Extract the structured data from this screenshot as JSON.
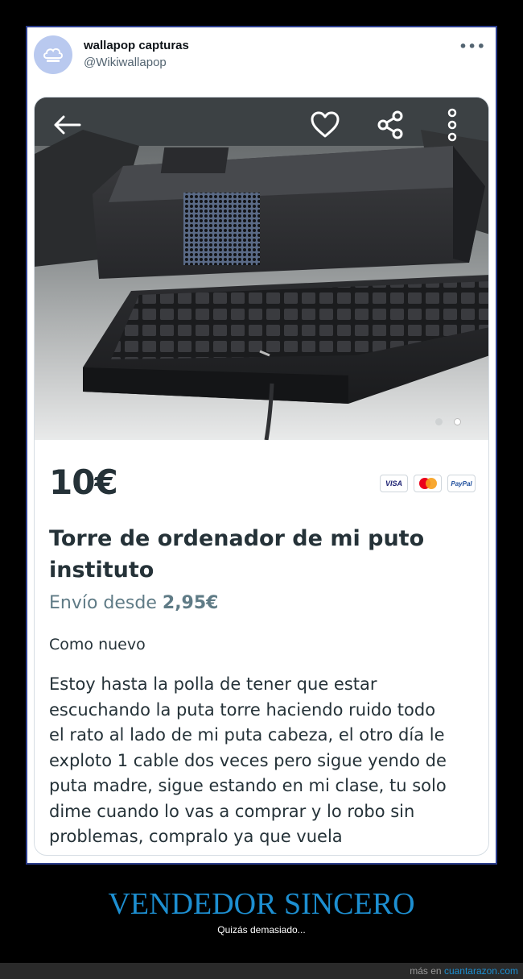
{
  "tweet": {
    "author_name": "wallapop capturas",
    "handle": "@Wikiwallapop",
    "more_icon": "more-horizontal-icon"
  },
  "listing": {
    "price": "10€",
    "payment_methods": [
      "VISA",
      "Mastercard",
      "PayPal"
    ],
    "title": "Torre de ordenador de mi puto instituto",
    "shipping_prefix": "Envío desde ",
    "shipping_price": "2,95€",
    "condition": "Como nuevo",
    "description": "Estoy hasta la polla de tener que estar\nescuchando la puta torre haciendo ruido todo\nel rato al lado de mi puta cabeza, el otro día le\nexploto 1 cable dos veces pero sigue yendo de\nputa madre, sigue estando en mi clase, tu solo\ndime cuando lo vas a comprar y lo robo sin\nproblemas, compralo ya que vuela",
    "photo_count": 2,
    "current_photo": 1
  },
  "icons": {
    "back": "arrow-left-icon",
    "favorite": "heart-icon",
    "share": "share-icon",
    "menu": "more-vertical-icon"
  },
  "caption": {
    "title": "VENDEDOR SINCERO",
    "subtitle": "Quizás demasiado..."
  },
  "footer": {
    "prefix": "más en ",
    "site": "cuantarazon.com"
  },
  "colors": {
    "brand_blue": "#1d8fd1",
    "frame_border": "#2b3d8c",
    "text_dark": "#253238",
    "text_muted": "#5f7b86"
  }
}
